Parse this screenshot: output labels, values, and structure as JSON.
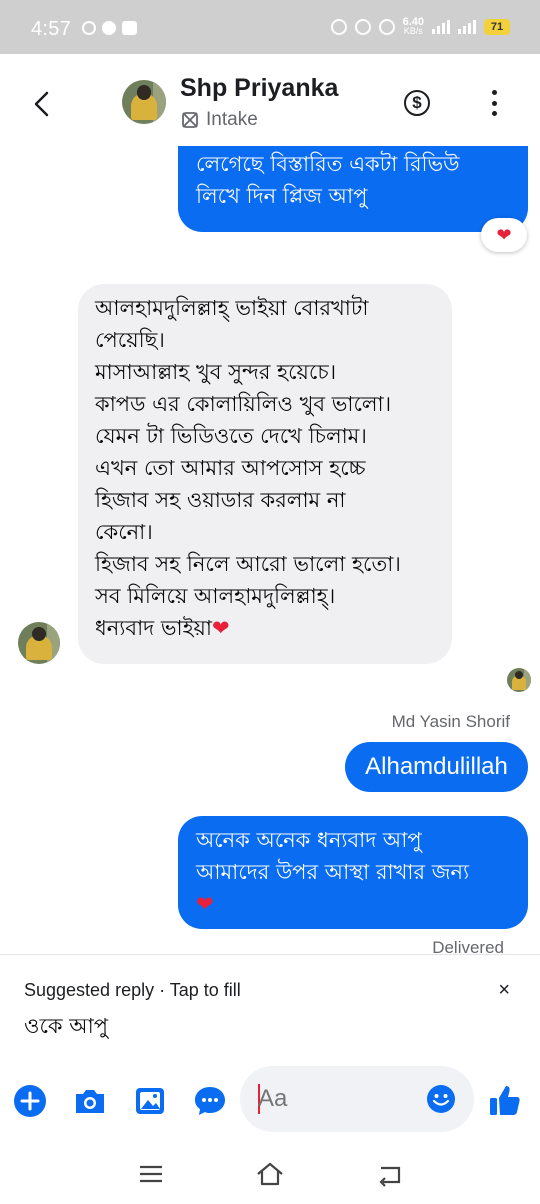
{
  "status_bar": {
    "time": "4:57",
    "net_speed_value": "6.40",
    "net_speed_unit": "KB/s",
    "battery": "71"
  },
  "header": {
    "back_icon": "chevron-left-icon",
    "contact_name": "Shp Priyanka",
    "contact_subtitle": "Intake",
    "subtitle_icon": "intake-icon",
    "payment_icon": "dollar-circle-icon",
    "more_icon": "more-vertical-icon"
  },
  "messages": {
    "m1_text": "লেগেছে বিস্তারিত একটা রিভিউ\nলিখে দিন প্লিজ আপু",
    "m1_reaction": "❤",
    "m2_text": "আলহামদুলিল্লাহ্ ভাইয়া বোরখাটা\nপেয়েছি।\nমাসাআল্লাহ খুব সুন্দর হয়েচে।\nকাপড এর কোলায়িলিও খুব ভালো।\nযেমন টা ভিডিওতে দেখে চিলাম।\nএখন তো আমার আপসোস হচ্চে\nহিজাব সহ ওয়াডার করলাম না\nকেনো।\nহিজাব সহ নিলে আরো ভালো হতো।\nসব মিলিয়ে আলহামদুলিল্লাহ্।\nধন্যবাদ ভাইয়া",
    "m2_heart": "❤",
    "sender_name": "Md Yasin Shorif",
    "m3_text": "Alhamdulillah",
    "m4_text": "অনেক অনেক ধন্যবাদ আপু\nআমাদের উপর আস্থা রাখার জন্য",
    "m4_heart": "❤",
    "delivered": "Delivered"
  },
  "suggested": {
    "label": "Suggested reply · Tap to fill",
    "close": "×",
    "text": "ওকে আপু"
  },
  "composer": {
    "placeholder": "Aa",
    "icons": [
      "plus-circle-icon",
      "camera-icon",
      "gallery-icon",
      "chat-bubble-icon",
      "emoji-icon",
      "thumbs-up-icon"
    ],
    "accent": "#0a6cf0"
  },
  "navbar": {
    "icons": [
      "menu-icon",
      "home-icon",
      "back-icon"
    ]
  },
  "colors": {
    "outgoing_bubble": "#0a6cf0",
    "incoming_bubble": "#f0f0f3",
    "heart": "#e8203a"
  }
}
